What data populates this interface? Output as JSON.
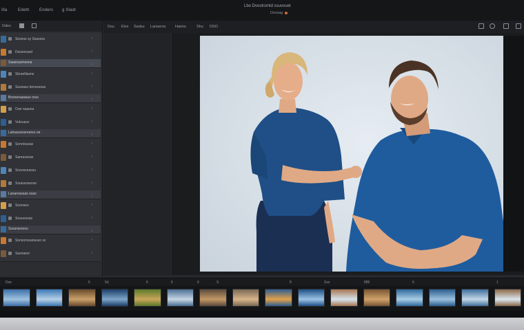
{
  "app": {
    "title": "Lbo Dvostrsmtd ssuvouet",
    "subtitle": "Dsvsag"
  },
  "menu": [
    {
      "label": "Illa"
    },
    {
      "label": "Edeth"
    },
    {
      "label": "Enders"
    },
    {
      "label": "g Sladr"
    }
  ],
  "sidebar": {
    "header": {
      "label": "Ddes",
      "icon1": "grid-icon",
      "icon2": "list-icon"
    },
    "rows": [
      {
        "label": "Seseus sy Ssassss",
        "type": "item"
      },
      {
        "label": "Dsosonasd",
        "type": "item"
      },
      {
        "label": "Saasnasmsona",
        "type": "group"
      },
      {
        "label": "Sbraelliasns",
        "type": "item"
      },
      {
        "label": "Sussasu bonssssas",
        "type": "item"
      },
      {
        "label": "Bosnenasasus orus",
        "type": "group"
      },
      {
        "label": "Ooe naasna",
        "type": "item"
      },
      {
        "label": "Vulouass",
        "type": "item"
      },
      {
        "label": "Lalnasooxsreeres oe",
        "type": "group"
      },
      {
        "label": "Sonntsusas",
        "type": "item"
      },
      {
        "label": "Sanrassnas",
        "type": "item"
      },
      {
        "label": "Snoossnassu",
        "type": "item"
      },
      {
        "label": "Ssrassvasnso",
        "type": "item"
      },
      {
        "label": "Lananrassas soas",
        "type": "group"
      },
      {
        "label": "Soonaso",
        "type": "item"
      },
      {
        "label": "Soouosoas",
        "type": "item"
      },
      {
        "label": "Sossnsrsnns",
        "type": "group"
      },
      {
        "label": "Sonsonssansuso sv",
        "type": "item"
      },
      {
        "label": "Sasnasor",
        "type": "item"
      }
    ]
  },
  "toolbar": {
    "items": [
      {
        "label": "Dsu"
      },
      {
        "label": "Elvs"
      },
      {
        "label": "Sadsu"
      },
      {
        "label": "Lanserss"
      },
      {
        "label": "Hanns"
      },
      {
        "label": "Shu"
      },
      {
        "label": "DSO"
      }
    ],
    "icons": [
      "crop-icon",
      "adjust-icon",
      "export-icon",
      "window-icon"
    ]
  },
  "timeline": {
    "labels": [
      "Dse",
      "6",
      "5d",
      "6",
      "6",
      "6",
      "S",
      "8",
      "Sss",
      "885",
      "6",
      "1"
    ]
  },
  "filmstrip": {
    "frames": [
      {
        "colors": [
          "#3b6fa8",
          "#9fc1de"
        ]
      },
      {
        "colors": [
          "#3a78b6",
          "#b6d0e6"
        ]
      },
      {
        "colors": [
          "#6a4a2a",
          "#c9a06b"
        ]
      },
      {
        "colors": [
          "#1d3f6a",
          "#7fa6c9"
        ]
      },
      {
        "colors": [
          "#5d7a2a",
          "#c8a65a"
        ]
      },
      {
        "colors": [
          "#4a6f94",
          "#c7d6e3"
        ]
      },
      {
        "colors": [
          "#5b4a3a",
          "#c39866"
        ]
      },
      {
        "colors": [
          "#7a6a55",
          "#d9b48a"
        ]
      },
      {
        "colors": [
          "#2f5e8f",
          "#e1a14b"
        ]
      },
      {
        "colors": [
          "#1e4f87",
          "#9dc4e6"
        ]
      },
      {
        "colors": [
          "#a77752",
          "#d6e3ed"
        ]
      },
      {
        "colors": [
          "#7a5633",
          "#cfa26b"
        ]
      },
      {
        "colors": [
          "#2f6a9c",
          "#a8cde5"
        ]
      },
      {
        "colors": [
          "#2a5f8f",
          "#9cc0dc"
        ]
      },
      {
        "colors": [
          "#3f6f9d",
          "#c3d7e6"
        ]
      },
      {
        "colors": [
          "#8c6a4a",
          "#dbe6ee"
        ]
      }
    ]
  },
  "photo": {
    "colors": {
      "shirt": "#1f4f86",
      "skin": "#e0a985",
      "hair_woman": "#d9b67a",
      "hair_man": "#4a3325",
      "pants": "#1b2f52"
    }
  }
}
